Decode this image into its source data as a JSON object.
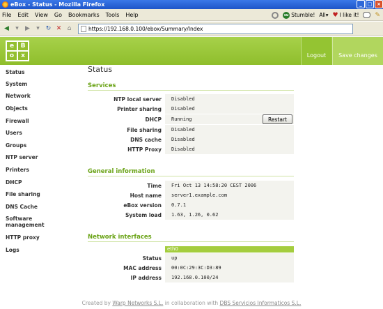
{
  "browser": {
    "title": "eBox - Status - Mozilla Firefox",
    "menu": [
      "File",
      "Edit",
      "View",
      "Go",
      "Bookmarks",
      "Tools",
      "Help"
    ],
    "stumble": "Stumble!",
    "all": "All▾",
    "ilike": "I like it!",
    "url": "https://192.168.0.100/ebox/Summary/Index"
  },
  "header": {
    "logo_letters": [
      "e",
      "B",
      "o",
      "x"
    ],
    "logout": "Logout",
    "save": "Save changes"
  },
  "sidebar": {
    "items": [
      {
        "label": "Status"
      },
      {
        "label": "System"
      },
      {
        "label": "Network"
      },
      {
        "label": "Objects"
      },
      {
        "label": "Firewall"
      },
      {
        "label": "Users"
      },
      {
        "label": "Groups"
      },
      {
        "label": "NTP server"
      },
      {
        "label": "Printers"
      },
      {
        "label": "DHCP"
      },
      {
        "label": "File sharing"
      },
      {
        "label": "DNS Cache"
      },
      {
        "label": "Software management"
      },
      {
        "label": "HTTP proxy"
      },
      {
        "label": "Logs"
      }
    ]
  },
  "main": {
    "title": "Status",
    "services": {
      "heading": "Services",
      "rows": [
        {
          "label": "NTP local server",
          "value": "Disabled"
        },
        {
          "label": "Printer sharing",
          "value": "Disabled"
        },
        {
          "label": "DHCP",
          "value": "Running"
        },
        {
          "label": "File sharing",
          "value": "Disabled"
        },
        {
          "label": "DNS cache",
          "value": "Disabled"
        },
        {
          "label": "HTTP Proxy",
          "value": "Disabled"
        }
      ],
      "restart_label": "Restart"
    },
    "general": {
      "heading": "General information",
      "rows": [
        {
          "label": "Time",
          "value": "Fri Oct 13 14:58:20 CEST 2006"
        },
        {
          "label": "Host name",
          "value": "server1.example.com"
        },
        {
          "label": "eBox version",
          "value": "0.7.1"
        },
        {
          "label": "System load",
          "value": "1.63, 1.26, 0.62"
        }
      ]
    },
    "network": {
      "heading": "Network interfaces",
      "iface": "eth0",
      "rows": [
        {
          "label": "Status",
          "value": "up"
        },
        {
          "label": "MAC address",
          "value": "00:0C:29:3C:D3:89"
        },
        {
          "label": "IP address",
          "value": "192.168.0.100/24"
        }
      ]
    }
  },
  "footer": {
    "prefix": "Created by ",
    "link1": "Warp Networks S.L.",
    "middle": " in collaboration with ",
    "link2": "DBS Servicios Informaticos S.L."
  },
  "colors": {
    "accent_green": "#8fbe2c",
    "section_green": "#6aa316"
  }
}
